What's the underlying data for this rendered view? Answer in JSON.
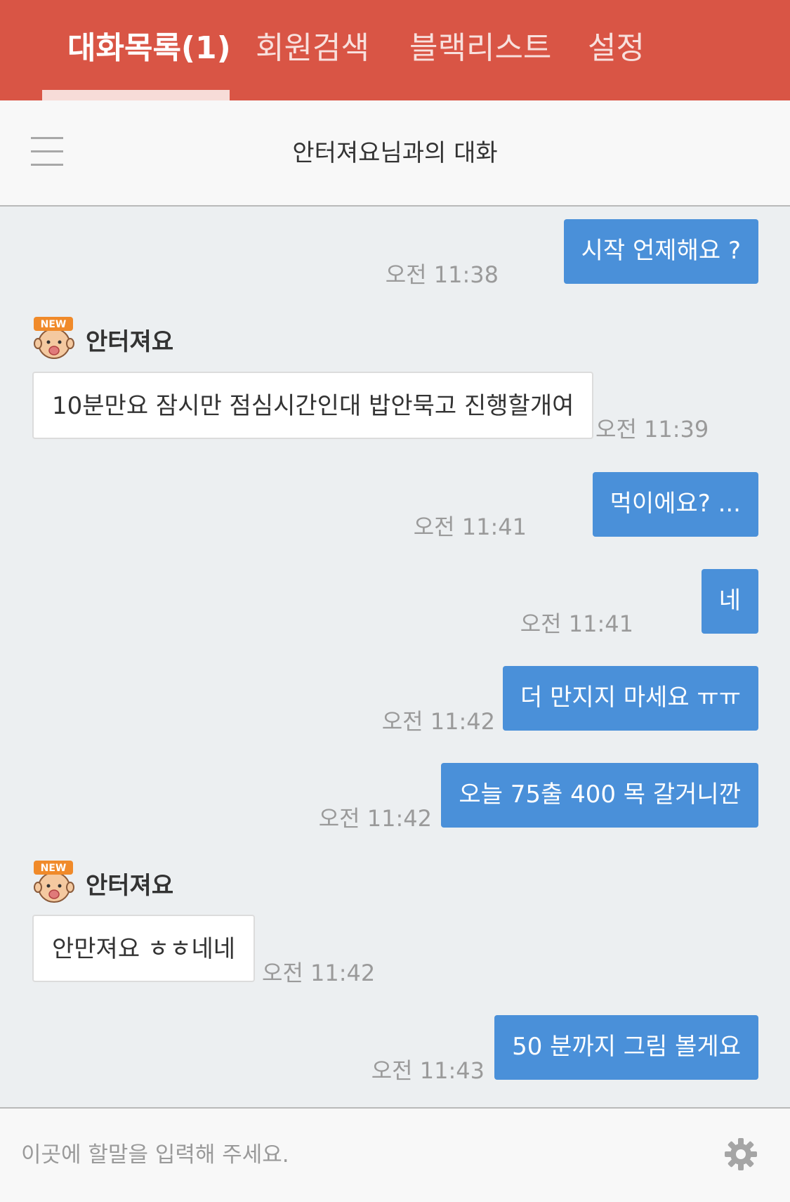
{
  "tabs": [
    {
      "label": "대화목록(1)",
      "active": true
    },
    {
      "label": "회원검색",
      "active": false
    },
    {
      "label": "블랙리스트",
      "active": false
    },
    {
      "label": "설정",
      "active": false
    }
  ],
  "header": {
    "menu_icon": "hamburger-menu-icon",
    "title": "안터져요님과의 대화"
  },
  "messages": [
    {
      "direction": "out",
      "text": "시작 언제해요 ?",
      "time": "오전 11:38"
    },
    {
      "direction": "in",
      "sender": "안터져요",
      "badge": "NEW",
      "text": "10분만요 잠시만 점심시간인대 밥안묵고 진행할개여",
      "time": "오전 11:39"
    },
    {
      "direction": "out",
      "text": "먹이에요? ...",
      "time": "오전 11:41"
    },
    {
      "direction": "out",
      "text": "네",
      "time": "오전 11:41"
    },
    {
      "direction": "out",
      "text": "더 만지지 마세요 ㅠㅠ",
      "time": "오전 11:42"
    },
    {
      "direction": "out",
      "text": "오늘 75출 400 목 갈거니깐",
      "time": "오전 11:42"
    },
    {
      "direction": "in",
      "sender": "안터져요",
      "badge": "NEW",
      "text": "안만져요 ㅎㅎ네네",
      "time": "오전 11:42"
    },
    {
      "direction": "out",
      "text": "50 분까지 그림 볼게요",
      "time": "오전 11:43"
    }
  ],
  "input": {
    "placeholder": "이곳에 할말을 입력해 주세요.",
    "value": ""
  },
  "colors": {
    "tabbar": "#d95545",
    "outgoing_bubble": "#4a90d9",
    "incoming_bubble": "#ffffff",
    "background": "#eceff1"
  },
  "icons": {
    "settings": "gear-icon",
    "avatar": "new-badge-avatar-icon"
  }
}
